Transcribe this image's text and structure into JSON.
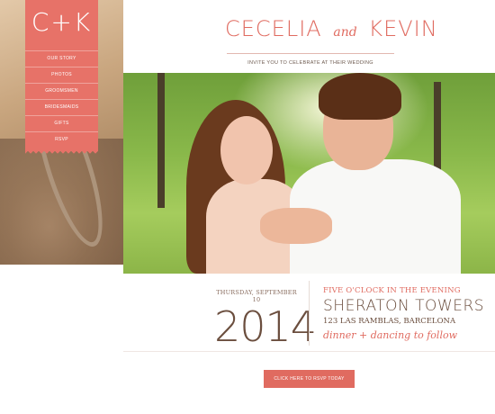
{
  "sidebar": {
    "logo": "C+K",
    "menu": [
      "OUR STORY",
      "PHOTOS",
      "GROOMSMEN",
      "BRIDESMAIDS",
      "GIFTS",
      "RSVP"
    ]
  },
  "header": {
    "name1": "CECELIA",
    "and": "and",
    "name2": "KEVIN",
    "invite": "INVITE YOU TO CELEBRATE AT THEIR WEDDING"
  },
  "event": {
    "weekday": "THURSDAY, SEPTEMBER 10",
    "year": "2014",
    "time": "FIVE O'CLOCK IN THE EVENING",
    "venue": "SHERATON TOWERS",
    "address": "123 LAS RAMBLAS, BARCELONA",
    "party": "dinner + dancing to follow"
  },
  "cta": {
    "label": "CLICK HERE TO RSVP TODAY"
  },
  "colors": {
    "accent": "#e06b60",
    "text": "#6b4e3e"
  }
}
